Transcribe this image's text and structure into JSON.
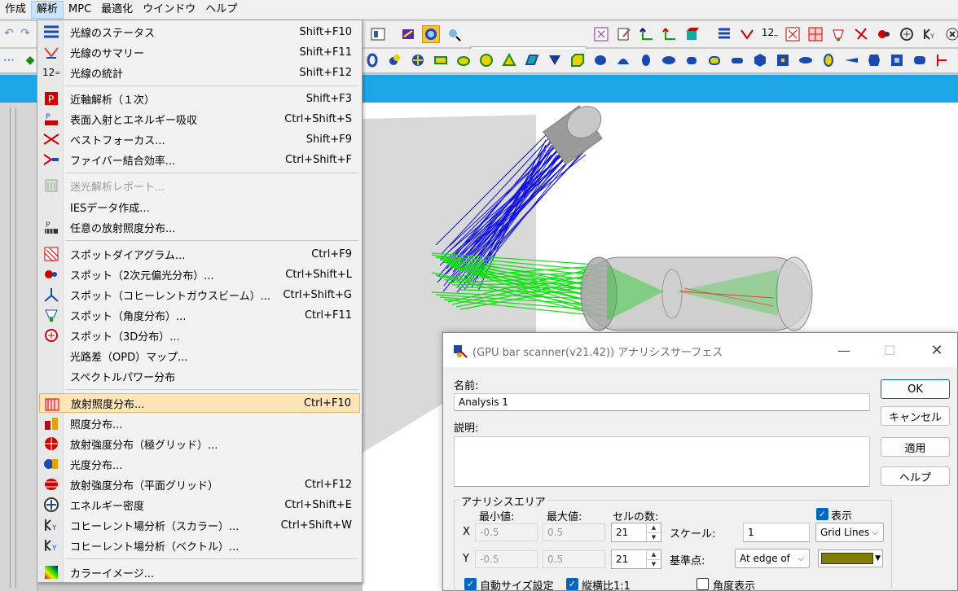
{
  "menubar": {
    "items": [
      "作成",
      "解析",
      "MPC",
      "最適化",
      "ウインドウ",
      "ヘルプ"
    ]
  },
  "toolbar": {
    "combo_value": "",
    "icons_row1": [
      "stop-icon",
      "circle-view-icon",
      "zoom-view-icon",
      "grid-icon",
      "edit-icon",
      "axis-icon",
      "axis-red-icon",
      "box-3d-icon",
      "list-icon",
      "ray-fan-icon",
      "12-icon",
      "spot-icon",
      "hatch-icon",
      "bar-icon",
      "scatter-icon",
      "polar-icon",
      "unit-icon",
      "cube-icon",
      "coherent-icon",
      "close-x-icon"
    ],
    "icons_row2": [
      "toroid-icon",
      "lens-pair-icon",
      "faceted-icon",
      "sphere-icon",
      "ellipsoid-icon",
      "paraboloid-icon",
      "cone-icon",
      "mesh-icon",
      "triangle-icon",
      "box-icon",
      "lens-icon",
      "dome-icon",
      "bullet-icon",
      "capsule-icon",
      "cylinder-icon",
      "prism-icon",
      "disk-icon",
      "hex-icon",
      "square-icon",
      "oval-icon",
      "half-icon",
      "wedge-icon",
      "cube-small-icon",
      "square-hole-icon",
      "pill-icon",
      "step-icon"
    ]
  },
  "menu": {
    "items": [
      {
        "label": "光線のステータス",
        "shortcut": "Shift+F10",
        "icon": "ray-status-icon"
      },
      {
        "label": "光線のサマリー",
        "shortcut": "Shift+F11",
        "icon": "ray-summary-icon"
      },
      {
        "label": "光線の統計",
        "shortcut": "Shift+F12",
        "icon": "ray-stats-icon"
      },
      {
        "label": "近軸解析（１次）",
        "shortcut": "Shift+F3",
        "icon": "paraxial-icon"
      },
      {
        "label": "表面入射とエネルギー吸収",
        "shortcut": "Ctrl+Shift+S",
        "icon": "surface-incidence-icon"
      },
      {
        "label": "ベストフォーカス...",
        "shortcut": "Shift+F9",
        "icon": "best-focus-icon"
      },
      {
        "label": "ファイバー結合効率...",
        "shortcut": "Ctrl+Shift+F",
        "icon": "fiber-coupling-icon"
      },
      {
        "label": "迷光解析レポート...",
        "shortcut": "",
        "icon": "stray-light-icon"
      },
      {
        "label": "IESデータ作成...",
        "shortcut": "",
        "icon": ""
      },
      {
        "label": "任意の放射照度分布...",
        "shortcut": "",
        "icon": "arbitrary-irradiance-icon"
      },
      {
        "label": "スポットダイアグラム...",
        "shortcut": "Ctrl+F9",
        "icon": "spot-diagram-icon"
      },
      {
        "label": "スポット（2次元偏光分布）...",
        "shortcut": "Ctrl+Shift+L",
        "icon": "spot-polarization-icon"
      },
      {
        "label": "スポット（コヒーレントガウスビーム）...",
        "shortcut": "Ctrl+Shift+G",
        "icon": "spot-gaussian-icon"
      },
      {
        "label": "スポット（角度分布）...",
        "shortcut": "Ctrl+F11",
        "icon": "spot-angle-icon"
      },
      {
        "label": "スポット（3D分布）...",
        "shortcut": "",
        "icon": "spot-3d-icon"
      },
      {
        "label": "光路差（OPD）マップ...",
        "shortcut": "",
        "icon": ""
      },
      {
        "label": "スペクトルパワー分布",
        "shortcut": "",
        "icon": ""
      },
      {
        "label": "放射照度分布...",
        "shortcut": "Ctrl+F10",
        "icon": "irradiance-icon"
      },
      {
        "label": "照度分布...",
        "shortcut": "",
        "icon": "illuminance-icon"
      },
      {
        "label": "放射強度分布（極グリッド）...",
        "shortcut": "",
        "icon": "intensity-polar-icon"
      },
      {
        "label": "光度分布...",
        "shortcut": "",
        "icon": "luminous-intensity-icon"
      },
      {
        "label": "放射強度分布（平面グリッド）",
        "shortcut": "Ctrl+F12",
        "icon": "intensity-planar-icon"
      },
      {
        "label": "エネルギー密度",
        "shortcut": "Ctrl+Shift+E",
        "icon": "energy-density-icon"
      },
      {
        "label": "コヒーレント場分析（スカラー）...",
        "shortcut": "Ctrl+Shift+W",
        "icon": "coherent-scalar-icon"
      },
      {
        "label": "コヒーレント場分析（ベクトル）...",
        "shortcut": "",
        "icon": "coherent-vector-icon"
      },
      {
        "label": "カラーイメージ...",
        "shortcut": "",
        "icon": "color-image-icon"
      }
    ]
  },
  "dialog": {
    "title": "(GPU bar scanner(v21.42)) アナリシスサーフェス",
    "name_label": "名前:",
    "name_value": "Analysis 1",
    "desc_label": "説明:",
    "desc_value": "",
    "buttons": {
      "ok": "OK",
      "cancel": "キャンセル",
      "apply": "適用",
      "help": "ヘルプ"
    },
    "area": {
      "title": "アナリシスエリア",
      "min_label": "最小値:",
      "max_label": "最大値:",
      "cells_label": "セルの数:",
      "x_label": "X",
      "y_label": "Y",
      "x_min": "-0.5",
      "x_max": "0.5",
      "x_cells": "21",
      "y_min": "-0.5",
      "y_max": "0.5",
      "y_cells": "21",
      "scale_label": "スケール:",
      "scale_value": "1",
      "ref_label": "基準点:",
      "ref_value": "At edge of",
      "show_label": "表示",
      "show_checked": true,
      "grid_value": "Grid Lines",
      "color": "#808000",
      "auto_size_label": "自動サイズ設定",
      "aspect_label": "縦横比1:1",
      "angle_label": "角度表示"
    }
  }
}
